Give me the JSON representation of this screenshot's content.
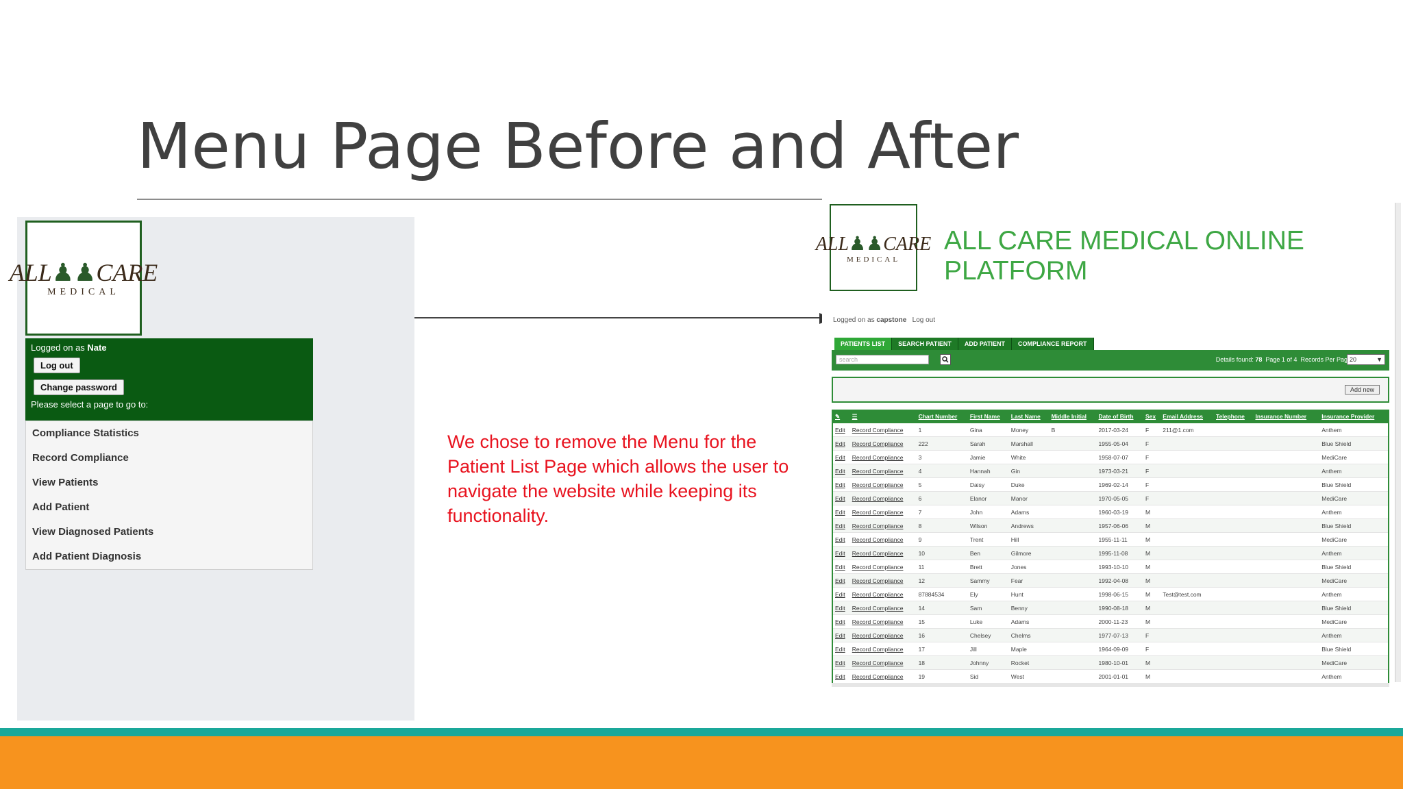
{
  "slide": {
    "title": "Menu Page Before and After",
    "caption": "We chose to remove the Menu for the Patient List Page which allows the user to navigate the website while keeping its functionality."
  },
  "before": {
    "logo": {
      "main_left": "ALL",
      "main_right": "CARE",
      "sub": "MEDICAL"
    },
    "logged_prefix": "Logged on as ",
    "user": "Nate",
    "logout_label": "Log out",
    "change_password_label": "Change password",
    "prompt": "Please select a page to go to:",
    "menu_items": [
      "Compliance Statistics",
      "Record Compliance",
      "View Patients",
      "Add Patient",
      "View Diagnosed Patients",
      "Add Patient Diagnosis"
    ]
  },
  "after": {
    "logo": {
      "main_left": "ALL",
      "main_right": "CARE",
      "sub": "MEDICAL"
    },
    "platform_title": "ALL CARE MEDICAL ONLINE PLATFORM",
    "logged_prefix": "Logged on as ",
    "user": "capstone",
    "logout_label": "Log out",
    "tabs": [
      "PATIENTS LIST",
      "SEARCH PATIENT",
      "ADD PATIENT",
      "COMPLIANCE REPORT"
    ],
    "search_placeholder": "search",
    "details_found_label": "Details found:",
    "details_found_value": "78",
    "page_label": "Page 1 of 4",
    "records_per_page_label": "Records Per Page",
    "records_per_page_value": "20",
    "add_new_label": "Add new",
    "columns": [
      "Chart Number",
      "First Name",
      "Last Name",
      "Middle Initial",
      "Date of Birth",
      "Sex",
      "Email Address",
      "Telephone",
      "Insurance Number",
      "Insurance Provider"
    ],
    "edit_label": "Edit",
    "record_label": "Record Compliance",
    "rows": [
      [
        "1",
        "Gina",
        "Money",
        "B",
        "2017-03-24",
        "F",
        "211@1.com",
        "",
        "",
        "Anthem"
      ],
      [
        "222",
        "Sarah",
        "Marshall",
        "",
        "1955-05-04",
        "F",
        "",
        "",
        "",
        "Blue Shield"
      ],
      [
        "3",
        "Jamie",
        "White",
        "",
        "1958-07-07",
        "F",
        "",
        "",
        "",
        "MediCare"
      ],
      [
        "4",
        "Hannah",
        "Gin",
        "",
        "1973-03-21",
        "F",
        "",
        "",
        "",
        "Anthem"
      ],
      [
        "5",
        "Daisy",
        "Duke",
        "",
        "1969-02-14",
        "F",
        "",
        "",
        "",
        "Blue Shield"
      ],
      [
        "6",
        "Elanor",
        "Manor",
        "",
        "1970-05-05",
        "F",
        "",
        "",
        "",
        "MediCare"
      ],
      [
        "7",
        "John",
        "Adams",
        "",
        "1960-03-19",
        "M",
        "",
        "",
        "",
        "Anthem"
      ],
      [
        "8",
        "Wilson",
        "Andrews",
        "",
        "1957-06-06",
        "M",
        "",
        "",
        "",
        "Blue Shield"
      ],
      [
        "9",
        "Trent",
        "Hill",
        "",
        "1955-11-11",
        "M",
        "",
        "",
        "",
        "MediCare"
      ],
      [
        "10",
        "Ben",
        "Gilmore",
        "",
        "1995-11-08",
        "M",
        "",
        "",
        "",
        "Anthem"
      ],
      [
        "11",
        "Brett",
        "Jones",
        "",
        "1993-10-10",
        "M",
        "",
        "",
        "",
        "Blue Shield"
      ],
      [
        "12",
        "Sammy",
        "Fear",
        "",
        "1992-04-08",
        "M",
        "",
        "",
        "",
        "MediCare"
      ],
      [
        "87884534",
        "Ely",
        "Hunt",
        "",
        "1998-06-15",
        "M",
        "Test@test.com",
        "",
        "",
        "Anthem"
      ],
      [
        "14",
        "Sam",
        "Benny",
        "",
        "1990-08-18",
        "M",
        "",
        "",
        "",
        "Blue Shield"
      ],
      [
        "15",
        "Luke",
        "Adams",
        "",
        "2000-11-23",
        "M",
        "",
        "",
        "",
        "MediCare"
      ],
      [
        "16",
        "Chelsey",
        "Chelms",
        "",
        "1977-07-13",
        "F",
        "",
        "",
        "",
        "Anthem"
      ],
      [
        "17",
        "Jill",
        "Maple",
        "",
        "1964-09-09",
        "F",
        "",
        "",
        "",
        "Blue Shield"
      ],
      [
        "18",
        "Johnny",
        "Rocket",
        "",
        "1980-10-01",
        "M",
        "",
        "",
        "",
        "MediCare"
      ],
      [
        "19",
        "Sid",
        "West",
        "",
        "2001-01-01",
        "M",
        "",
        "",
        "",
        "Anthem"
      ]
    ]
  },
  "colors": {
    "title_text": "#404040",
    "caption_red": "#e8131f",
    "platform_green": "#3ea744",
    "menu_dark_green": "#0a5a12",
    "table_green": "#2e8c37",
    "footer_teal": "#1aa89a",
    "footer_orange": "#f7931e"
  }
}
